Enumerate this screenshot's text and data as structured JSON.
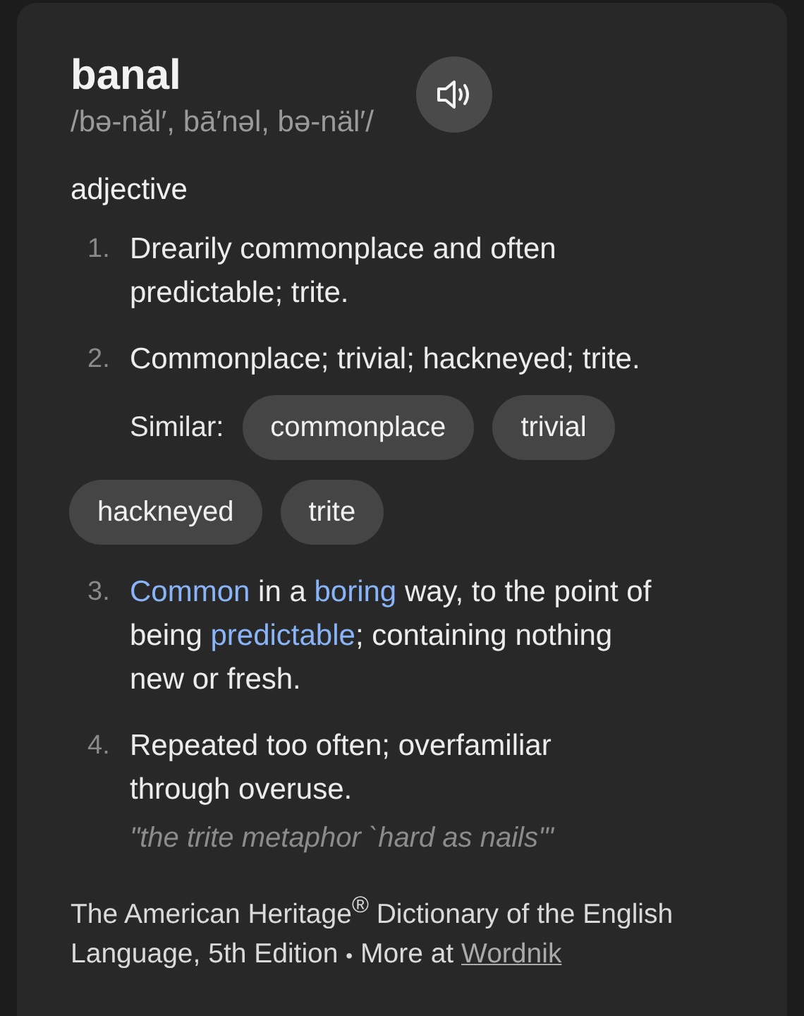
{
  "entry": {
    "word": "banal",
    "pronunciation": "/bə-năl′, bā′nəl, bə-näl′/"
  },
  "part_of_speech": "adjective",
  "definitions": [
    {
      "number": "1.",
      "segments": [
        {
          "text": "Drearily commonplace and often predictable; trite.",
          "link": false
        }
      ]
    },
    {
      "number": "2.",
      "segments": [
        {
          "text": "Commonplace; trivial; hackneyed; trite.",
          "link": false
        }
      ],
      "similar_label": "Similar:",
      "similar": [
        "commonplace",
        "trivial",
        "hackneyed",
        "trite"
      ]
    },
    {
      "number": "3.",
      "segments": [
        {
          "text": "Common",
          "link": true
        },
        {
          "text": " in a ",
          "link": false
        },
        {
          "text": "boring",
          "link": true
        },
        {
          "text": " way, to the point of being ",
          "link": false
        },
        {
          "text": "predictable",
          "link": true
        },
        {
          "text": "; containing nothing new or fresh.",
          "link": false
        }
      ]
    },
    {
      "number": "4.",
      "segments": [
        {
          "text": "Repeated too often; overfamiliar through overuse.",
          "link": false
        }
      ],
      "example": "\"the trite metaphor `hard as nails'\""
    }
  ],
  "footer": {
    "source": "The American Heritage$^{®}$ Dictionary of the English Language, 5th Edition",
    "separator": "•",
    "more_label": "More at",
    "link": "Wordnik"
  }
}
